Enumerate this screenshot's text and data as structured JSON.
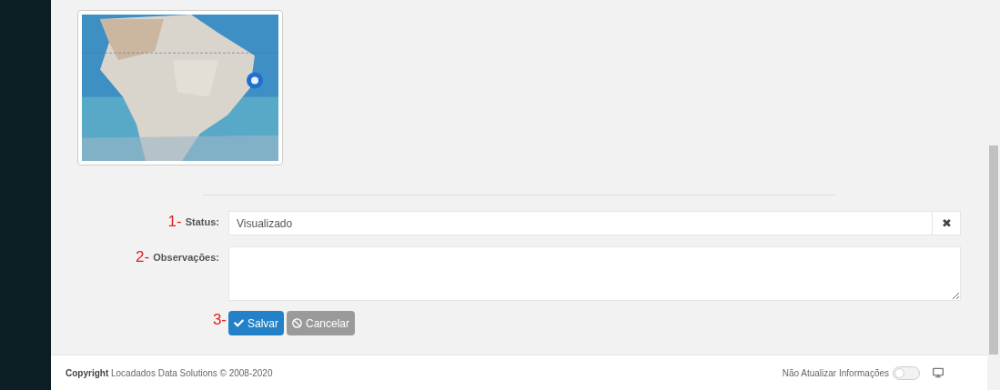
{
  "form": {
    "fields": [
      {
        "kind": "select",
        "marker": "1-",
        "label": "Status:",
        "value": "Visualizado",
        "clear": "✖"
      },
      {
        "kind": "textarea",
        "marker": "2-",
        "label": "Observações:"
      }
    ],
    "marker": "3-",
    "buttons": [
      {
        "kind": "primary",
        "label": "Salvar",
        "disabled": false
      },
      {
        "kind": "secondary",
        "label": "Cancelar",
        "disabled": true
      }
    ]
  },
  "footer": {
    "copyright_bold": "Copyright",
    "copyright": "Locadados Data Solutions © 2008-2020",
    "toggle_label": "Não Atualizar Informações",
    "on": false
  }
}
